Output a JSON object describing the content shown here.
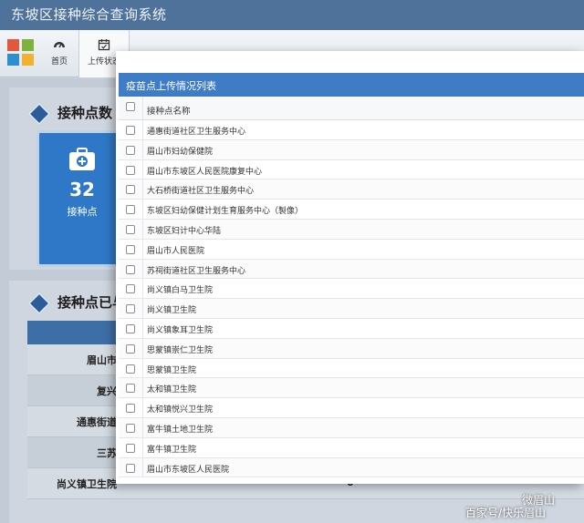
{
  "app": {
    "title": "东坡区接种综合查询系统"
  },
  "toolbar": {
    "tabs": [
      {
        "label": "首页",
        "icon": "dashboard-icon"
      },
      {
        "label": "上传状态",
        "icon": "calendar-icon"
      }
    ]
  },
  "dashboard": {
    "section1_title": "接种点数",
    "card": {
      "value": "32",
      "label": "接种点",
      "icon": "medical-kit-icon"
    },
    "section2_title": "接种点已与",
    "rows": [
      {
        "name": "眉山市",
        "count": ""
      },
      {
        "name": "复兴",
        "count": ""
      },
      {
        "name": "通惠街道",
        "count": ""
      },
      {
        "name": "三苏",
        "count": ""
      },
      {
        "name": "尚义镇卫生院",
        "count": "0"
      }
    ]
  },
  "modal": {
    "title": "疫苗点上传情况列表",
    "column_header": "接种点名称",
    "items": [
      "通惠街道社区卫生服务中心",
      "眉山市妇幼保健院",
      "眉山市东坡区人民医院康复中心",
      "大石桥街道社区卫生服务中心",
      "东坡区妇幼保健计划生育服务中心（製像）",
      "东坡区妇计中心华陆",
      "眉山市人民医院",
      "苏祠街道社区卫生服务中心",
      "尚义镇白马卫生院",
      "尚义镇卫生院",
      "尚义镇象耳卫生院",
      "思蒙镇崇仁卫生院",
      "思蒙镇卫生院",
      "太和镇卫生院",
      "太和镇悦兴卫生院",
      "富牛镇土地卫生院",
      "富牛镇卫生院",
      "眉山市东坡区人民医院"
    ]
  },
  "watermark": {
    "brand": "微眉山",
    "source": "百家号/快乐眉山"
  },
  "colors": {
    "header": "#4e7299",
    "modal_header": "#3f7cc6",
    "card": "#2e78c7",
    "diamond": "#2c5d9b"
  }
}
